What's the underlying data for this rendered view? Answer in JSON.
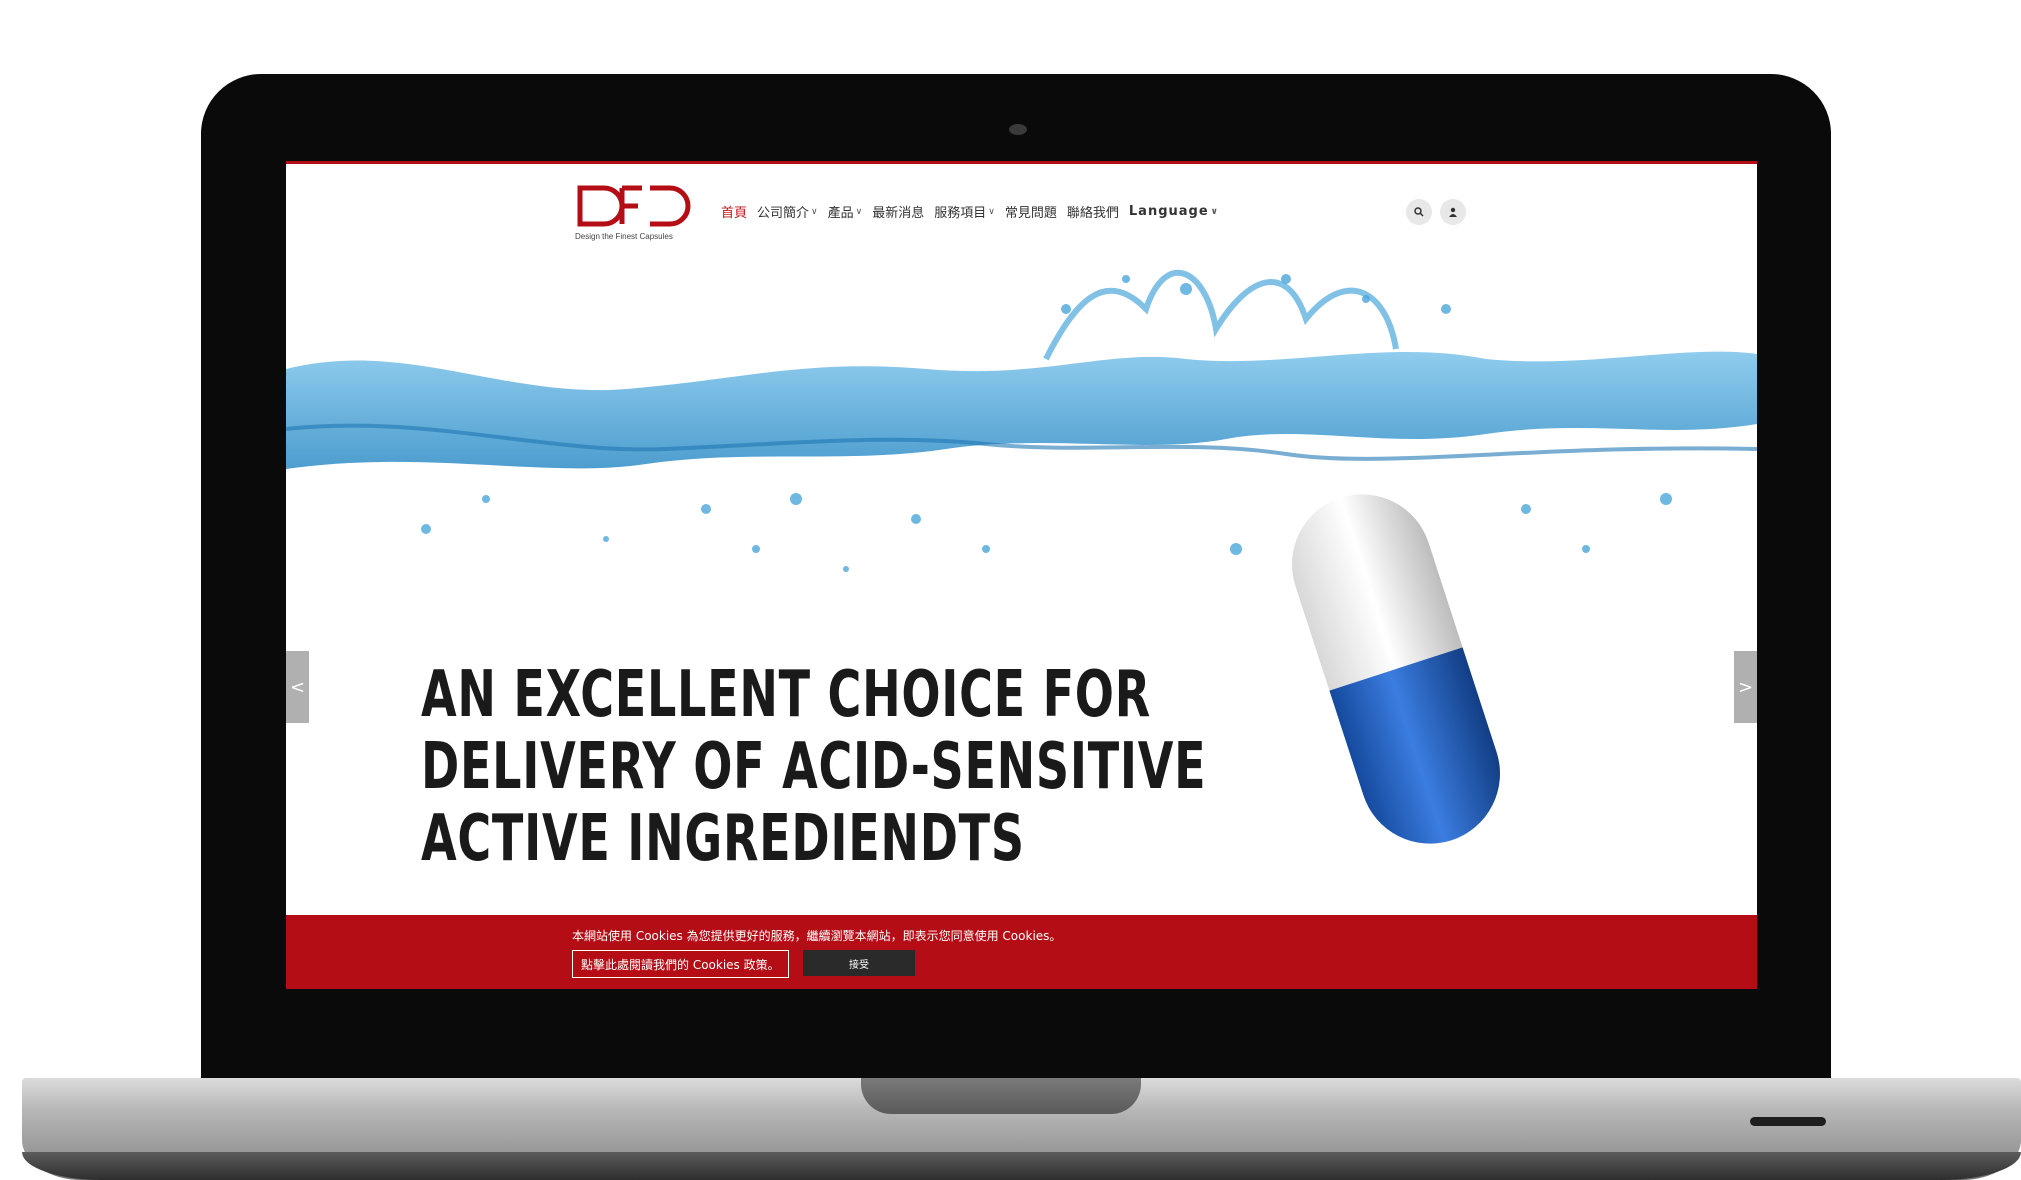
{
  "logo": {
    "tagline": "Design the Finest Capsules"
  },
  "nav": {
    "items": [
      {
        "label": "首頁",
        "active": true
      },
      {
        "label": "公司簡介",
        "dropdown": true
      },
      {
        "label": "產品",
        "dropdown": true
      },
      {
        "label": "最新消息"
      },
      {
        "label": "服務項目",
        "dropdown": true
      },
      {
        "label": "常見問題"
      },
      {
        "label": "聯絡我們"
      },
      {
        "label": "Language",
        "dropdown": true
      }
    ]
  },
  "header_icons": [
    "search-icon",
    "user-icon"
  ],
  "hero": {
    "headline_lines": [
      "AN EXCELLENT CHOICE FOR",
      "DELIVERY OF ACID-SENSITIVE",
      "ACTIVE INGREDIENDTS"
    ],
    "prev_arrow": "<",
    "next_arrow": ">"
  },
  "cookie": {
    "message": "本網站使用 Cookies 為您提供更好的服務，繼續瀏覽本網站，即表示您同意使用 Cookies。",
    "policy_link": "點擊此處閱讀我們的 Cookies 政策。",
    "accept": "接受"
  },
  "colors": {
    "brand_red": "#b40d15",
    "capsule_blue": "#1f62c9",
    "water_blue": "#3a9bd1"
  }
}
